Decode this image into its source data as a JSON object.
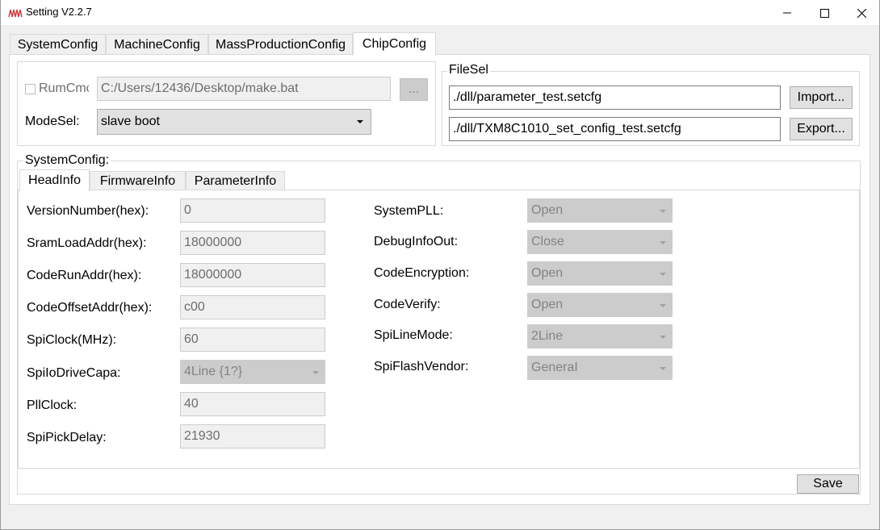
{
  "window": {
    "title": "Setting  V2.2.7",
    "icon": "waveform-icon",
    "controls": [
      "minimize-icon",
      "maximize-icon",
      "close-icon"
    ]
  },
  "tabs": [
    {
      "label": "SystemConfig",
      "active": false
    },
    {
      "label": "MachineConfig",
      "active": false
    },
    {
      "label": "MassProductionConfig",
      "active": false
    },
    {
      "label": "ChipConfig",
      "active": true
    }
  ],
  "run": {
    "checkbox_label": "RumCmc",
    "path_value": "C:/Users/12436/Desktop/make.bat",
    "browse_label": "...",
    "mode_label": "ModeSel:",
    "mode_value": "slave boot"
  },
  "filesel": {
    "title": "FileSel",
    "import_path": "./dll/parameter_test.setcfg",
    "import_label": "Import...",
    "export_path": "./dll/TXM8C1010_set_config_test.setcfg",
    "export_label": "Export..."
  },
  "sysconfig": {
    "title": "SystemConfig:",
    "tabs": [
      {
        "label": "HeadInfo",
        "active": true
      },
      {
        "label": "FirmwareInfo",
        "active": false
      },
      {
        "label": "ParameterInfo",
        "active": false
      }
    ],
    "left_fields": [
      {
        "label": "VersionNumber(hex):",
        "value": "0",
        "kind": "text"
      },
      {
        "label": "SramLoadAddr(hex):",
        "value": "18000000",
        "kind": "text"
      },
      {
        "label": "CodeRunAddr(hex):",
        "value": "18000000",
        "kind": "text"
      },
      {
        "label": "CodeOffsetAddr(hex):",
        "value": "c00",
        "kind": "text"
      },
      {
        "label": "SpiClock(MHz):",
        "value": "60",
        "kind": "text"
      },
      {
        "label": "SpiIoDriveCapa:",
        "value": "4Line {1?}",
        "kind": "combo"
      },
      {
        "label": "PllClock:",
        "value": "40",
        "kind": "text"
      },
      {
        "label": "SpiPickDelay:",
        "value": "21930",
        "kind": "text"
      }
    ],
    "right_fields": [
      {
        "label": "SystemPLL:",
        "value": "Open"
      },
      {
        "label": "DebugInfoOut:",
        "value": "Close"
      },
      {
        "label": "CodeEncryption:",
        "value": "Open"
      },
      {
        "label": "CodeVerify:",
        "value": "Open"
      },
      {
        "label": "SpiLineMode:",
        "value": "2Line"
      },
      {
        "label": "SpiFlashVendor:",
        "value": "GeneraI"
      }
    ]
  },
  "save_label": "Save"
}
